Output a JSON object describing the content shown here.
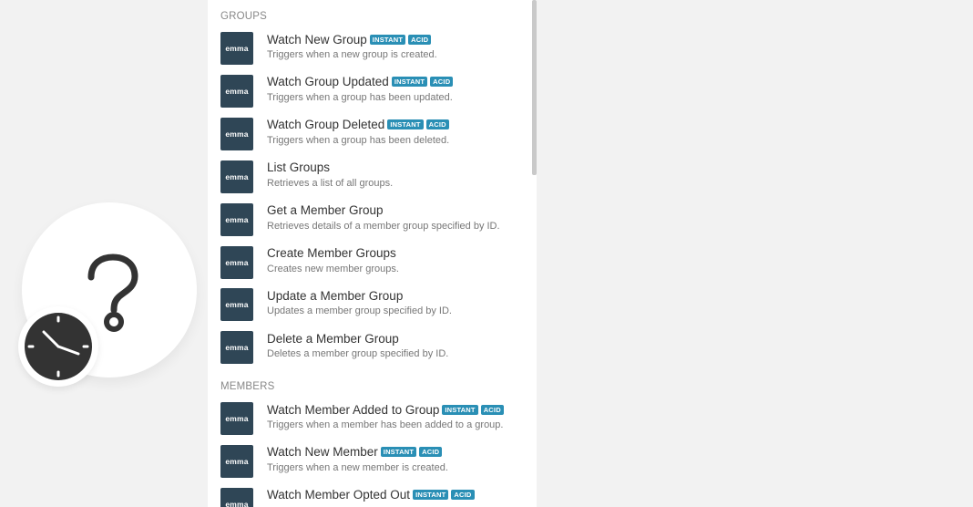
{
  "app_icon_label": "emma",
  "colors": {
    "badge": "#2a8fb5",
    "app_icon_bg": "#2f4656",
    "panel_bg": "#ffffff",
    "page_bg": "#f2f2f2"
  },
  "icons": {
    "placeholder": "question-mark-icon",
    "trigger": "clock-icon"
  },
  "sections": [
    {
      "title": "GROUPS",
      "items": [
        {
          "title": "Watch New Group",
          "badges": [
            "INSTANT",
            "ACID"
          ],
          "desc": "Triggers when a new group is created."
        },
        {
          "title": "Watch Group Updated",
          "badges": [
            "INSTANT",
            "ACID"
          ],
          "desc": "Triggers when a group has been updated."
        },
        {
          "title": "Watch Group Deleted",
          "badges": [
            "INSTANT",
            "ACID"
          ],
          "desc": "Triggers when a group has been deleted."
        },
        {
          "title": "List Groups",
          "badges": [],
          "desc": "Retrieves a list of all groups."
        },
        {
          "title": "Get a Member Group",
          "badges": [],
          "desc": "Retrieves details of a member group specified by ID."
        },
        {
          "title": "Create Member Groups",
          "badges": [],
          "desc": "Creates new member groups."
        },
        {
          "title": "Update a Member Group",
          "badges": [],
          "desc": "Updates a member group specified by ID."
        },
        {
          "title": "Delete a Member Group",
          "badges": [],
          "desc": "Deletes a member group specified by ID."
        }
      ]
    },
    {
      "title": "MEMBERS",
      "items": [
        {
          "title": "Watch Member Added to Group",
          "badges": [
            "INSTANT",
            "ACID"
          ],
          "desc": "Triggers when a member has been added to a group."
        },
        {
          "title": "Watch New Member",
          "badges": [
            "INSTANT",
            "ACID"
          ],
          "desc": "Triggers when a new member is created."
        },
        {
          "title": "Watch Member Opted Out",
          "badges": [
            "INSTANT",
            "ACID"
          ],
          "desc": ""
        }
      ]
    }
  ]
}
